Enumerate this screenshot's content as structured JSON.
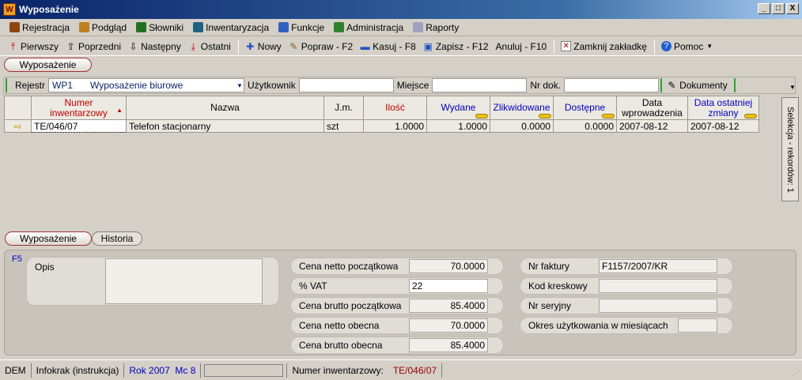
{
  "window": {
    "title": "Wyposażenie",
    "btn_min": "_",
    "btn_max": "□",
    "btn_close": "X"
  },
  "menu": [
    {
      "label": "Rejestracja",
      "color": "#8b4513"
    },
    {
      "label": "Podgląd",
      "color": "#c08020"
    },
    {
      "label": "Słowniki",
      "color": "#207020"
    },
    {
      "label": "Inwentaryzacja",
      "color": "#206080"
    },
    {
      "label": "Funkcje",
      "color": "#3060c0"
    },
    {
      "label": "Administracja",
      "color": "#308030"
    },
    {
      "label": "Raporty",
      "color": "#a0a0c0"
    }
  ],
  "toolbar": {
    "first": "Pierwszy",
    "prev": "Poprzedni",
    "next": "Następny",
    "last": "Ostatni",
    "new": "Nowy",
    "edit": "Popraw - F2",
    "delete": "Kasuj - F8",
    "save": "Zapisz - F12",
    "cancel": "Anuluj - F10",
    "close_tab": "Zamknij zakładkę",
    "help": "Pomoc"
  },
  "main_tab": "Wyposażenie",
  "filter": {
    "register_label": "Rejestr",
    "register_code": "WP1",
    "register_name": "Wyposażenie biurowe",
    "user_label": "Użytkownik",
    "user_value": "",
    "place_label": "Miejsce",
    "place_value": "",
    "doc_no_label": "Nr dok.",
    "doc_no_value": "",
    "documents_label": "Dokumenty"
  },
  "grid": {
    "headers": {
      "number_l1": "Numer",
      "number_l2": "inwentarzowy",
      "name": "Nazwa",
      "unit": "J.m.",
      "qty": "Ilość",
      "issued": "Wydane",
      "liquidated": "Zlikwidowane",
      "available": "Dostępne",
      "date_in_l1": "Data",
      "date_in_l2": "wprowadzenia",
      "date_change_l1": "Data ostatniej",
      "date_change_l2": "zmiany"
    },
    "rows": [
      {
        "number": "TE/046/07",
        "name": "Telefon stacjonarny",
        "unit": "szt",
        "qty": "1.0000",
        "issued": "1.0000",
        "liquidated": "0.0000",
        "available": "0.0000",
        "date_in": "2007-08-12",
        "date_change": "2007-08-12"
      }
    ]
  },
  "side_panel": "Selekcja - rekordów: 1",
  "detail_tabs": {
    "equipment": "Wyposażenie",
    "history": "Historia"
  },
  "detail": {
    "hotkey": "F5",
    "description_label": "Opis",
    "description_value": "",
    "net_initial_label": "Cena netto początkowa",
    "net_initial_value": "70.0000",
    "vat_label": "% VAT",
    "vat_value": "22",
    "gross_initial_label": "Cena brutto początkowa",
    "gross_initial_value": "85.4000",
    "net_current_label": "Cena netto obecna",
    "net_current_value": "70.0000",
    "gross_current_label": "Cena brutto obecna",
    "gross_current_value": "85.4000",
    "invoice_label": "Nr faktury",
    "invoice_value": "F1157/2007/KR",
    "barcode_label": "Kod kreskowy",
    "barcode_value": "",
    "serial_label": "Nr seryjny",
    "serial_value": "",
    "usage_label": "Okres użytkowania w miesiącach",
    "usage_value": ""
  },
  "status": {
    "company": "DEM",
    "db": "Infokrak (instrukcja)",
    "year": "Rok 2007",
    "month": "Mc 8",
    "inv_label": "Numer inwentarzowy:",
    "inv_value": "TE/046/07"
  }
}
